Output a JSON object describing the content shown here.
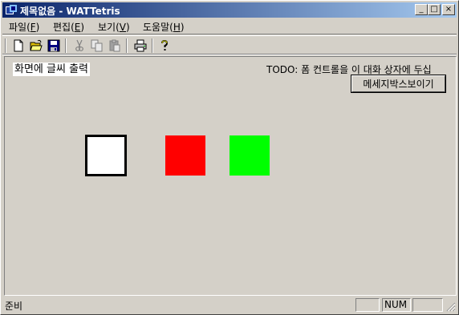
{
  "window": {
    "title": "제목없음 - WATTetris",
    "minimize_glyph": "_",
    "maximize_glyph": "□",
    "close_glyph": "×"
  },
  "menu": {
    "items": [
      {
        "label": "파일(",
        "key": "F",
        "tail": ")"
      },
      {
        "label": "편집(",
        "key": "E",
        "tail": ")"
      },
      {
        "label": "보기(",
        "key": "V",
        "tail": ")"
      },
      {
        "label": "도움말(",
        "key": "H",
        "tail": ")"
      }
    ]
  },
  "toolbar": {
    "icons": [
      "new-document-icon",
      "open-folder-icon",
      "save-disk-icon",
      "cut-scissors-icon",
      "copy-icon",
      "paste-icon",
      "print-icon",
      "help-icon"
    ]
  },
  "content": {
    "hello_text": "화면에 글씨 출력",
    "todo_text": "TODO: 폼 컨트롤을 이 대화 상자에 두십",
    "message_button_label": "메세지박스보이기",
    "blocks": [
      {
        "name": "white-block",
        "color": "#ffffff"
      },
      {
        "name": "red-block",
        "color": "#ff0000"
      },
      {
        "name": "green-block",
        "color": "#00ff00"
      }
    ]
  },
  "status": {
    "text": "준비",
    "num_indicator": "NUM"
  }
}
